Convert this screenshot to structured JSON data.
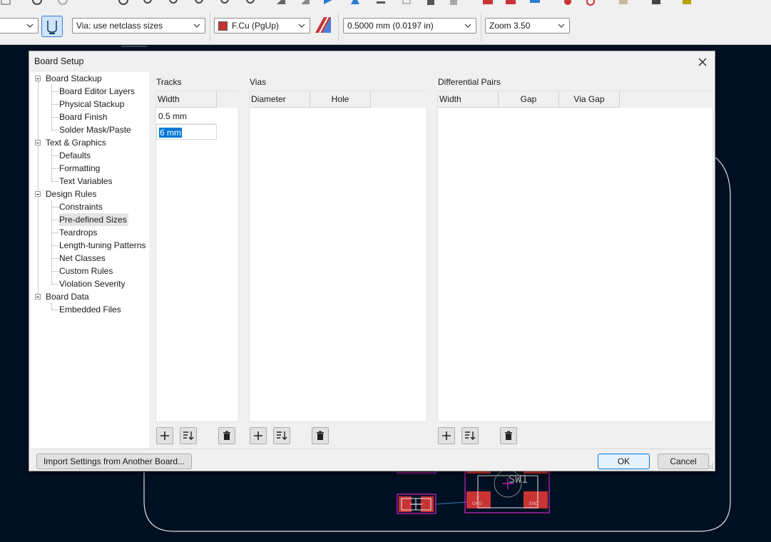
{
  "toolbar": {
    "via_select": "Via: use netclass sizes",
    "layer_select": "F.Cu (PgUp)",
    "track_width_select": "0.5000 mm (0.0197 in)",
    "zoom_select": "Zoom 3.50",
    "layer_color": "#c83434"
  },
  "pcb": {
    "ref_label": "SW1",
    "pad_labels": [
      "2",
      "GND",
      "END"
    ],
    "pad_color": "#c83434",
    "outline_color": "#e0e0e0",
    "courtyard_color": "#ff26e2"
  },
  "dialog": {
    "title": "Board Setup",
    "tree": [
      {
        "label": "Board Stackup",
        "level": 0
      },
      {
        "label": "Board Editor Layers",
        "level": 1
      },
      {
        "label": "Physical Stackup",
        "level": 1
      },
      {
        "label": "Board Finish",
        "level": 1
      },
      {
        "label": "Solder Mask/Paste",
        "level": 1
      },
      {
        "label": "Text & Graphics",
        "level": 0
      },
      {
        "label": "Defaults",
        "level": 1
      },
      {
        "label": "Formatting",
        "level": 1
      },
      {
        "label": "Text Variables",
        "level": 1
      },
      {
        "label": "Design Rules",
        "level": 0
      },
      {
        "label": "Constraints",
        "level": 1
      },
      {
        "label": "Pre-defined Sizes",
        "level": 1,
        "selected": true
      },
      {
        "label": "Teardrops",
        "level": 1
      },
      {
        "label": "Length-tuning Patterns",
        "level": 1
      },
      {
        "label": "Net Classes",
        "level": 1
      },
      {
        "label": "Custom Rules",
        "level": 1
      },
      {
        "label": "Violation Severity",
        "level": 1
      },
      {
        "label": "Board Data",
        "level": 0
      },
      {
        "label": "Embedded Files",
        "level": 1
      }
    ],
    "tracks": {
      "label": "Tracks",
      "columns": [
        "Width"
      ],
      "rows": [
        "0.5 mm",
        "6 mm"
      ]
    },
    "vias": {
      "label": "Vias",
      "columns": [
        "Diameter",
        "Hole"
      ]
    },
    "diff_pairs": {
      "label": "Differential Pairs",
      "columns": [
        "Width",
        "Gap",
        "Via Gap"
      ]
    },
    "buttons": {
      "import": "Import Settings from Another Board...",
      "ok": "OK",
      "cancel": "Cancel"
    }
  }
}
